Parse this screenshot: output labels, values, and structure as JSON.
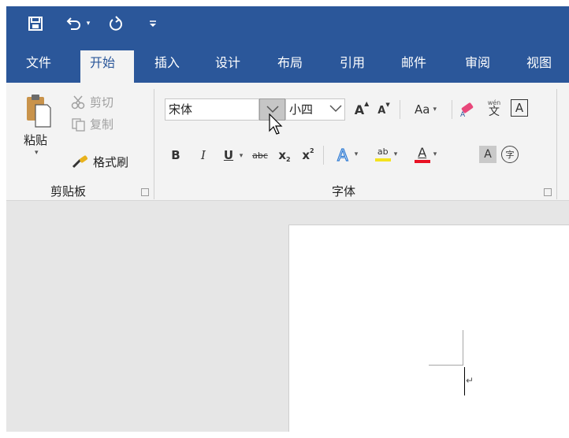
{
  "quick_access": {
    "save_icon": "save-icon",
    "undo_icon": "undo-icon",
    "redo_icon": "redo-icon",
    "customize_icon": "customize-toolbar-icon"
  },
  "tabs": [
    {
      "label": "文件",
      "active": false
    },
    {
      "label": "开始",
      "active": true
    },
    {
      "label": "插入",
      "active": false
    },
    {
      "label": "设计",
      "active": false
    },
    {
      "label": "布局",
      "active": false
    },
    {
      "label": "引用",
      "active": false
    },
    {
      "label": "邮件",
      "active": false
    },
    {
      "label": "审阅",
      "active": false
    },
    {
      "label": "视图",
      "active": false
    }
  ],
  "clipboard": {
    "paste_label": "粘贴",
    "cut_label": "剪切",
    "copy_label": "复制",
    "format_painter_label": "格式刷",
    "group_label": "剪贴板"
  },
  "font": {
    "font_name": "宋体",
    "font_size": "小四",
    "change_case_label": "Aa",
    "bold": "B",
    "italic": "I",
    "underline": "U",
    "strikethrough": "abc",
    "subscript": "x",
    "subscript_mark": "2",
    "superscript": "x",
    "superscript_mark": "2",
    "phonetic_top": "wén",
    "phonetic_char": "文",
    "char_border": "A",
    "font_color_letter": "A",
    "shading_letter": "A",
    "enclose_char": "字",
    "highlight_label": "ab",
    "group_label": "字体"
  },
  "colors": {
    "title_bar": "#2b579a",
    "ribbon": "#f3f3f3",
    "highlight_yellow": "#f4e21e",
    "font_color_red": "#e81123"
  },
  "document": {
    "paragraph_mark": "↵"
  }
}
